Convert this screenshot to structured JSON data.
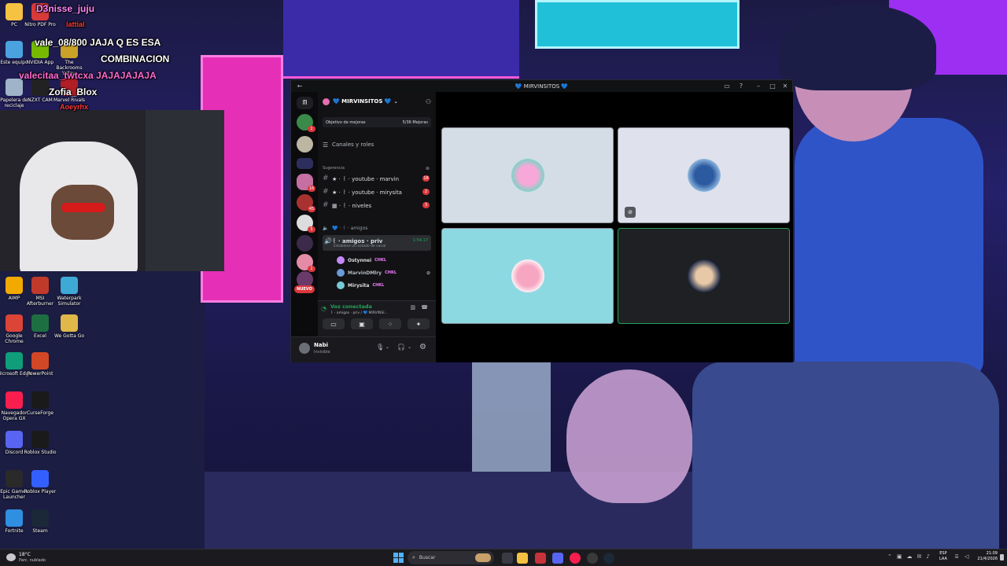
{
  "desktop": {
    "icons": [
      {
        "label": "PC",
        "icon": "folder-icon",
        "color": "#f5c242"
      },
      {
        "label": "Nitro PDF Pro",
        "icon": "pdf-icon",
        "color": "#d83a3a"
      },
      {
        "label": "Este equipo",
        "icon": "computer-icon",
        "color": "#4aa3df"
      },
      {
        "label": "NVIDIA App",
        "icon": "nvidia-icon",
        "color": "#76b900"
      },
      {
        "label": "The Backrooms Yellow",
        "icon": "game-icon",
        "color": "#c9a227"
      },
      {
        "label": "Papelera de reciclaje",
        "icon": "recycle-bin-icon",
        "color": "#9fb4c8"
      },
      {
        "label": "NZXT CAM",
        "icon": "nzxt-icon",
        "color": "#222222"
      },
      {
        "label": "Marvel Rivals",
        "icon": "marvel-icon",
        "color": "#b11e25"
      },
      {
        "label": "AIMP",
        "icon": "aimp-icon",
        "color": "#f2a900"
      },
      {
        "label": "MSI Afterburner",
        "icon": "msi-icon",
        "color": "#c0392b"
      },
      {
        "label": "Waterpark Simulator",
        "icon": "waterpark-icon",
        "color": "#3fa9d6"
      },
      {
        "label": "Google Chrome",
        "icon": "chrome-icon",
        "color": "#db4437"
      },
      {
        "label": "Excel",
        "icon": "excel-icon",
        "color": "#1d6f42"
      },
      {
        "label": "We Gotta Go",
        "icon": "game-icon",
        "color": "#e0b84a"
      },
      {
        "label": "Microsoft Edge",
        "icon": "edge-icon",
        "color": "#0f9d7a"
      },
      {
        "label": "PowerPoint",
        "icon": "powerpoint-icon",
        "color": "#d24726"
      },
      {
        "label": "Navegador Opera GX",
        "icon": "opera-gx-icon",
        "color": "#fa1e4e"
      },
      {
        "label": "CurseForge",
        "icon": "curseforge-icon",
        "color": "#1a1a1a"
      },
      {
        "label": "Discord",
        "icon": "discord-icon",
        "color": "#5865f2"
      },
      {
        "label": "Roblox Studio",
        "icon": "roblox-studio-icon",
        "color": "#1a1a1a"
      },
      {
        "label": "Epic Games Launcher",
        "icon": "epic-icon",
        "color": "#2a2a2a"
      },
      {
        "label": "Roblox Player",
        "icon": "roblox-icon",
        "color": "#335fff"
      },
      {
        "label": "Fortnite",
        "icon": "fortnite-icon",
        "color": "#2f8fe0"
      },
      {
        "label": "Steam",
        "icon": "steam-icon",
        "color": "#1b2838"
      }
    ]
  },
  "overlay_chat": [
    {
      "text": "D3nisse_juju",
      "color": "#ff88ff"
    },
    {
      "text": "lattial",
      "color": "#ff3b3b"
    },
    {
      "text": "vale_08/800  JAJA Q ES ESA",
      "color": "#ffffff"
    },
    {
      "text": "COMBINACION",
      "color": "#ffffff"
    },
    {
      "text": "valecitaa_twtcxa  JAJAJAJAJA",
      "color": "#ff6ad5"
    },
    {
      "text": "Zofia_Blox",
      "color": "#ffffff"
    },
    {
      "text": "Aoeyrhx",
      "color": "#ff3b3b"
    }
  ],
  "discord": {
    "window_title": "💙 MIRVINSITOS 💙",
    "server_name": "💙 MIRVINSITOS 💙",
    "boost_goal": {
      "label": "Objetivo de mejoras",
      "count": "5/36 Mejoras"
    },
    "channels_roles": "Canales y roles",
    "suggestion_header": "Sugerencia",
    "channels": [
      {
        "name": "★ · ꒰ · youtube · marvin",
        "badge": "18"
      },
      {
        "name": "★ · ꒰ · youtube · mirysita",
        "badge": "2"
      },
      {
        "name": "▦ · ꒰ · niveles",
        "badge": "3"
      }
    ],
    "category": "💙 · ꒰ · amigos",
    "voice_channel": {
      "name": "꒰ · amigos · priv",
      "timer": "1:54:17",
      "status": "Establece un estado de canal"
    },
    "voice_users": [
      {
        "name": "Ostynnei",
        "tag": "CHKL",
        "color": "#c58af9"
      },
      {
        "name": "MarvinDMlry",
        "tag": "CHKL",
        "color": "#6a9bd8"
      },
      {
        "name": "Mirysita",
        "tag": "CHKL",
        "color": "#78c9d6"
      }
    ],
    "new_badge": "NUEVO",
    "voice_status": {
      "title": "Voz conectada",
      "subtitle": "꒰ · amigos · priv / 💙 MIRVINSI..."
    },
    "user": {
      "name": "Nabi",
      "status": "Invisible"
    },
    "server_badges": [
      "1",
      "16",
      "45",
      "5",
      "1"
    ]
  },
  "taskbar": {
    "weather_temp": "18°C",
    "weather_desc": "Parc. nublado",
    "search_placeholder": "Buscar",
    "lang_top": "ESP",
    "lang_bottom": "LAA",
    "time": "21:09",
    "date": "21/4/2026"
  }
}
